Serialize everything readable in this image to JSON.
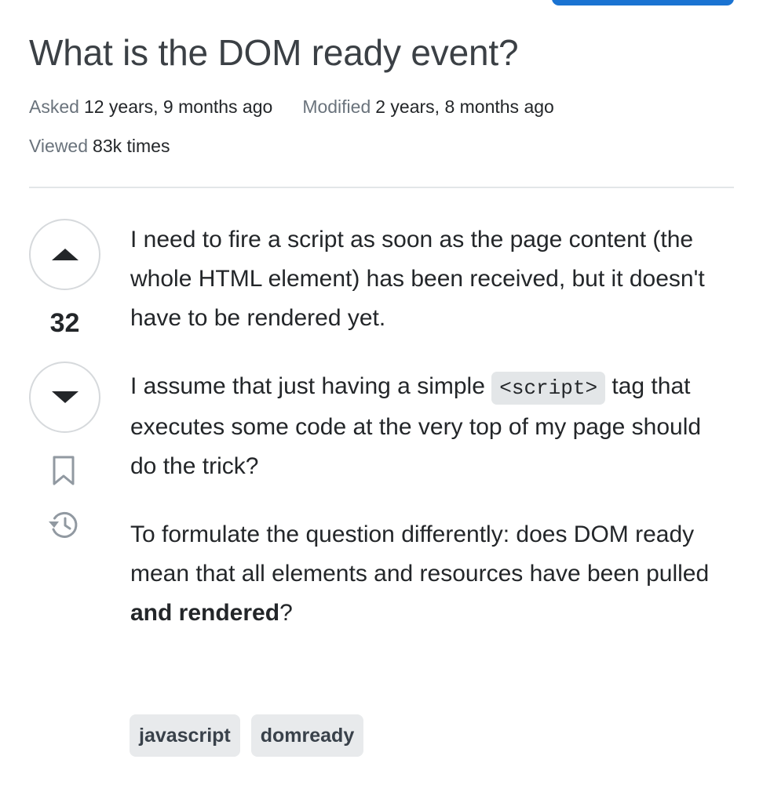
{
  "question": {
    "title": "What is the DOM ready event?",
    "asked_label": "Asked",
    "asked_value": "12 years, 9 months ago",
    "modified_label": "Modified",
    "modified_value": "2 years, 8 months ago",
    "viewed_label": "Viewed",
    "viewed_value": "83k times"
  },
  "votes": {
    "count": "32",
    "upvote_icon": "triangle-up-icon",
    "downvote_icon": "triangle-down-icon",
    "bookmark_icon": "bookmark-icon",
    "history_icon": "history-icon"
  },
  "body": {
    "p1": "I need to fire a script as soon as the page content (the whole HTML element) has been received, but it doesn't have to be rendered yet.",
    "p2_before": "I assume that just having a simple ",
    "p2_code": "<script>",
    "p2_after": " tag that executes some code at the very top of my page should do the trick?",
    "p3_before": "To formulate the question differently: does DOM ready mean that all elements and resources have been pulled ",
    "p3_bold": "and rendered",
    "p3_after": "?"
  },
  "tags": [
    "javascript",
    "domready"
  ],
  "colors": {
    "accent": "#1a73d2",
    "text": "#232629",
    "muted": "#6a737c",
    "tag_bg": "#e8eaec"
  }
}
